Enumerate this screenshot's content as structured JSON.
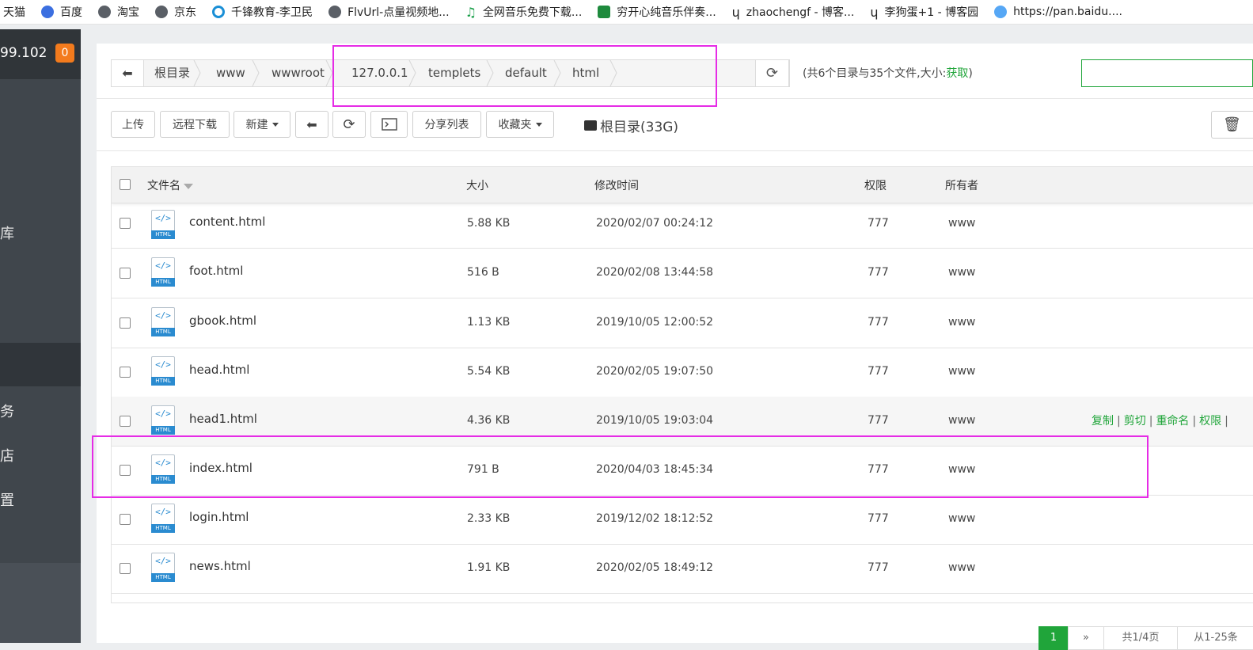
{
  "bookmarks": [
    {
      "label": "天猫",
      "icon": "tmall-icon"
    },
    {
      "label": "百度",
      "icon": "baidu-paw-icon"
    },
    {
      "label": "淘宝",
      "icon": "globe-icon"
    },
    {
      "label": "京东",
      "icon": "globe-icon"
    },
    {
      "label": "千锋教育-李卫民",
      "icon": "qianfeng-icon"
    },
    {
      "label": "FlvUrl-点量视频地...",
      "icon": "globe-icon"
    },
    {
      "label": "全网音乐免费下载...",
      "icon": "music-note-icon"
    },
    {
      "label": "穷开心纯音乐伴奏...",
      "icon": "play-icon"
    },
    {
      "label": "zhaochengf - 博客...",
      "icon": "blog-icon"
    },
    {
      "label": "李狗蛋+1 - 博客园",
      "icon": "blog-icon"
    },
    {
      "label": "https://pan.baidu....",
      "icon": "baidu-pan-icon"
    }
  ],
  "sidebar": {
    "ip_fragment": "99.102",
    "badge_count": "0",
    "items": [
      "库",
      "务",
      "店",
      "置"
    ]
  },
  "breadcrumb": {
    "items": [
      "根目录",
      "www",
      "wwwroot",
      "127.0.0.1",
      "templets",
      "default",
      "html"
    ]
  },
  "summary": {
    "text": "(共6个目录与35个文件,大小:",
    "link": "获取",
    "close": ")"
  },
  "toolbar": {
    "upload": "上传",
    "remote_download": "远程下载",
    "new": "新建",
    "share_list": "分享列表",
    "favorites": "收藏夹",
    "disk_label": "根目录(33G)"
  },
  "table": {
    "columns": {
      "name": "文件名",
      "size": "大小",
      "mtime": "修改时间",
      "perm": "权限",
      "owner": "所有者"
    },
    "icon_tag": "HTML",
    "icon_code": "</>",
    "rows": [
      {
        "name": "content.html",
        "size": "5.88 KB",
        "mtime": "2020/02/07 00:24:12",
        "perm": "777",
        "owner": "www"
      },
      {
        "name": "foot.html",
        "size": "516 B",
        "mtime": "2020/02/08 13:44:58",
        "perm": "777",
        "owner": "www"
      },
      {
        "name": "gbook.html",
        "size": "1.13 KB",
        "mtime": "2019/10/05 12:00:52",
        "perm": "777",
        "owner": "www"
      },
      {
        "name": "head.html",
        "size": "5.54 KB",
        "mtime": "2020/02/05 19:07:50",
        "perm": "777",
        "owner": "www"
      },
      {
        "name": "head1.html",
        "size": "4.36 KB",
        "mtime": "2019/10/05 19:03:04",
        "perm": "777",
        "owner": "www"
      },
      {
        "name": "index.html",
        "size": "791 B",
        "mtime": "2020/04/03 18:45:34",
        "perm": "777",
        "owner": "www"
      },
      {
        "name": "login.html",
        "size": "2.33 KB",
        "mtime": "2019/12/02 18:12:52",
        "perm": "777",
        "owner": "www"
      },
      {
        "name": "news.html",
        "size": "1.91 KB",
        "mtime": "2020/02/05 18:49:12",
        "perm": "777",
        "owner": "www"
      }
    ],
    "row_ops": [
      "复制",
      "剪切",
      "重命名",
      "权限"
    ]
  },
  "pagination": {
    "current": "1",
    "next": "»",
    "page_info": "共1/4页",
    "count_info": "从1-25条"
  },
  "colors": {
    "accent_green": "#20a53a",
    "highlight_magenta": "#e62ce6",
    "sidebar_bg": "#40464c",
    "badge_orange": "#f37b1d"
  }
}
